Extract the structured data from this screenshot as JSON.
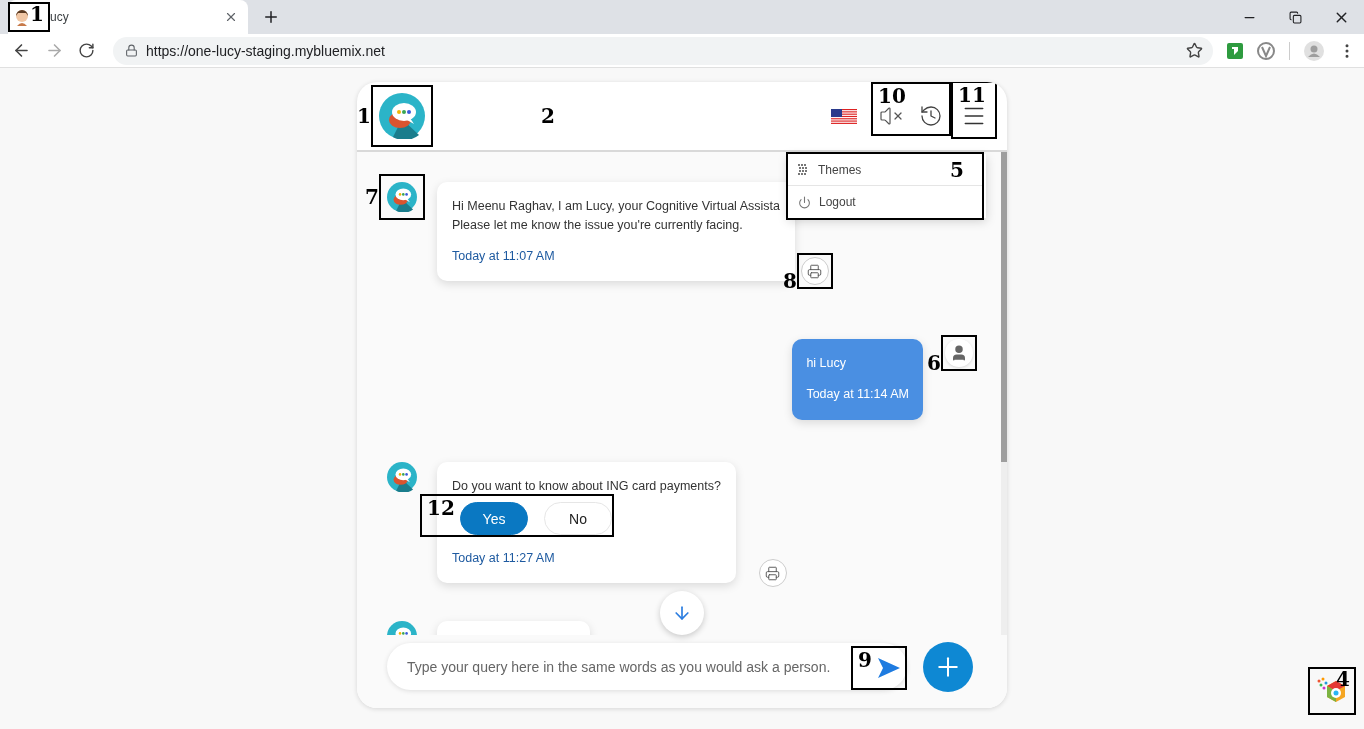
{
  "browser": {
    "tab": {
      "title": "ucy",
      "annotation": "1"
    },
    "url": "https://one-lucy-staging.mybluemix.net"
  },
  "chat": {
    "header": {
      "logo_annotation": "1",
      "label": "2",
      "controls_annotation": "10",
      "menu_annotation": "11"
    },
    "menu": {
      "annotation": "5",
      "items": [
        {
          "label": "Themes",
          "kind": "themes"
        },
        {
          "label": "Logout",
          "kind": "logout"
        }
      ]
    },
    "messages": [
      {
        "kind": "bot",
        "lines": [
          "Hi Meenu Raghav, I am Lucy, your Cognitive Virtual Assista",
          "Please let me know the issue you're currently facing."
        ],
        "time": "Today at 11:07 AM",
        "avatar_annotation": "7",
        "print_annotation": "8"
      },
      {
        "kind": "user",
        "lines": [
          "hi Lucy"
        ],
        "time": "Today at 11:14 AM",
        "avatar_annotation": "6"
      },
      {
        "kind": "bot",
        "lines": [
          "Do you want to know about ING card payments?"
        ],
        "time": "Today at 11:27 AM",
        "options_annotation": "12",
        "options": [
          {
            "label": "Yes",
            "selected": true
          },
          {
            "label": "No",
            "selected": false
          }
        ]
      },
      {
        "kind": "bot_cut"
      }
    ],
    "input": {
      "placeholder": "Type your query here in the same words as you would ask a person.",
      "send_annotation": "9"
    }
  },
  "corner_logo": {
    "annotation": "4"
  }
}
